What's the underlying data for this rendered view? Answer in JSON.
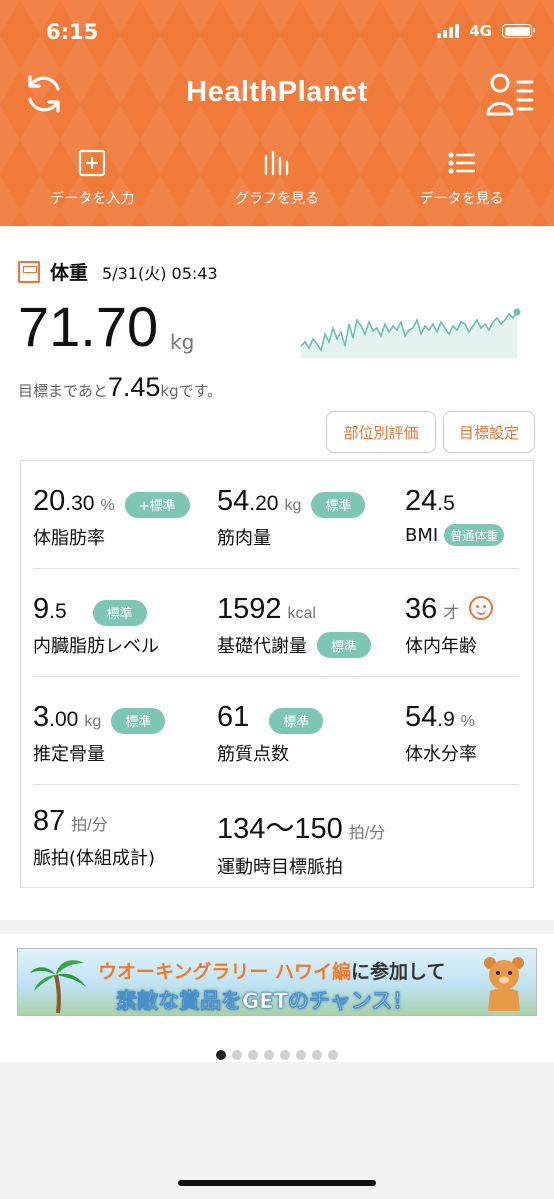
{
  "status_bar": {
    "time": "6:15",
    "network": "4G"
  },
  "header": {
    "brand": "HealthPlanet",
    "refresh_icon": "refresh-icon",
    "profile_icon": "profile-list-icon",
    "accent_color": "#f07a3a"
  },
  "toolbar": {
    "input_label": "データを入力",
    "graph_label": "グラフを見る",
    "data_label": "データを見る"
  },
  "weight": {
    "title": "体重",
    "date": "5/31(火) 05:43",
    "value": "71.70",
    "unit": "kg",
    "goal_prefix": "目標まであと",
    "goal_value": "7.45",
    "goal_suffix": "kgです。",
    "trend": [
      62,
      58,
      64,
      55,
      60,
      66,
      50,
      58,
      44,
      55,
      48,
      62,
      40,
      54,
      36,
      42,
      50,
      38,
      47,
      44,
      52,
      40,
      48,
      42,
      46,
      38,
      52,
      46,
      44,
      36,
      50,
      42,
      46,
      40,
      48,
      38,
      44,
      50,
      42,
      46,
      38,
      40,
      48,
      42,
      36,
      44,
      40,
      46,
      38,
      34,
      40,
      36,
      30,
      34,
      28
    ]
  },
  "buttons": {
    "parts": "部位別評価",
    "goal": "目標設定"
  },
  "metrics": {
    "body_fat": {
      "int": "20",
      "dec": ".30",
      "unit": "%",
      "badge": "+標準",
      "label": "体脂肪率"
    },
    "muscle": {
      "int": "54",
      "dec": ".20",
      "unit": "kg",
      "badge": "標準",
      "label": "筋肉量"
    },
    "bmi": {
      "int": "24",
      "dec": ".5",
      "label": "BMI",
      "badge": "普通体重"
    },
    "visceral": {
      "int": "9",
      "dec": ".5",
      "badge": "標準",
      "label": "内臓脂肪レベル"
    },
    "bmr": {
      "int": "1592",
      "unit": "kcal",
      "label": "基礎代謝量",
      "badge": "標準"
    },
    "body_age": {
      "int": "36",
      "unit": "才",
      "label": "体内年齢"
    },
    "bone": {
      "int": "3",
      "dec": ".00",
      "unit": "kg",
      "badge": "標準",
      "label": "推定骨量"
    },
    "muscle_score": {
      "int": "61",
      "badge": "標準",
      "label": "筋質点数"
    },
    "water": {
      "int": "54",
      "dec": ".9",
      "unit": "%",
      "label": "体水分率"
    },
    "pulse": {
      "int": "87",
      "unit": "拍/分",
      "label": "脈拍(体組成計)"
    },
    "target_pulse": {
      "int": "134〜150",
      "unit": "拍/分",
      "label": "運動時目標脈拍"
    }
  },
  "banner": {
    "line1_a": "ウオーキングラリー ハワイ編",
    "line1_b": "に参加して",
    "line2": "素敵な賞品をGETのチャンス！",
    "page_count": 8,
    "active_page": 1
  }
}
